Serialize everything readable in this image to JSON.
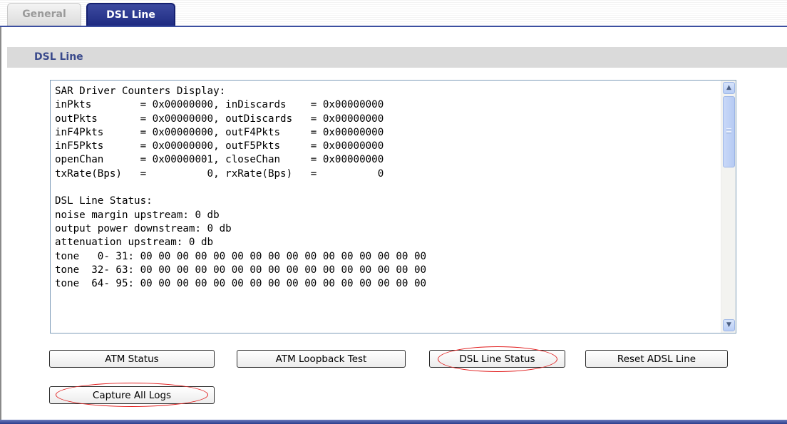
{
  "tabs": [
    {
      "label": "General",
      "active": false
    },
    {
      "label": "DSL Line",
      "active": true
    }
  ],
  "section": {
    "title": "DSL Line"
  },
  "log_lines": [
    "SAR Driver Counters Display:",
    "inPkts        = 0x00000000, inDiscards    = 0x00000000",
    "outPkts       = 0x00000000, outDiscards   = 0x00000000",
    "inF4Pkts      = 0x00000000, outF4Pkts     = 0x00000000",
    "inF5Pkts      = 0x00000000, outF5Pkts     = 0x00000000",
    "openChan      = 0x00000001, closeChan     = 0x00000000",
    "txRate(Bps)   =          0, rxRate(Bps)   =          0",
    "",
    "DSL Line Status:",
    "noise margin upstream: 0 db",
    "output power downstream: 0 db",
    "attenuation upstream: 0 db",
    "tone   0- 31: 00 00 00 00 00 00 00 00 00 00 00 00 00 00 00 00",
    "tone  32- 63: 00 00 00 00 00 00 00 00 00 00 00 00 00 00 00 00",
    "tone  64- 95: 00 00 00 00 00 00 00 00 00 00 00 00 00 00 00 00"
  ],
  "buttons": {
    "atm_status": "ATM Status",
    "atm_loopback": "ATM Loopback Test",
    "dsl_line_status": "DSL Line Status",
    "reset_adsl": "Reset ADSL Line",
    "capture_all_logs": "Capture All Logs"
  },
  "colors": {
    "active_tab": "#1f2b82",
    "section_title": "#3a4a8c",
    "highlight_ellipse": "#e11b1b"
  },
  "icons": {
    "scroll_up": "scroll-up-arrow-icon",
    "scroll_down": "scroll-down-arrow-icon"
  }
}
